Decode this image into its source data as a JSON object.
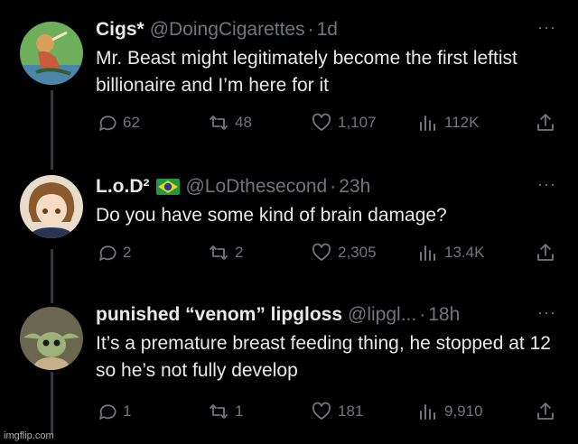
{
  "tweets": [
    {
      "name": "Cigs*",
      "handle": "@DoingCigarettes",
      "dot": "·",
      "time": "1d",
      "text": "Mr. Beast might legitimately become the first leftist billionaire and I’m here for it",
      "replies": "62",
      "retweets": "48",
      "likes": "1,107",
      "views": "112K",
      "more": "···"
    },
    {
      "name": "L.o.D²",
      "handle": "@LoDthesecond",
      "dot": "·",
      "time": "23h",
      "text": "Do you have some kind of brain damage?",
      "replies": "2",
      "retweets": "2",
      "likes": "2,305",
      "views": "13.4K",
      "more": "···"
    },
    {
      "name": "punished “venom” lipgloss",
      "handle": "@lipgl...",
      "dot": "·",
      "time": "18h",
      "text": "It’s a premature breast feeding thing, he stopped at 12 so he’s not fully develop",
      "replies": "1",
      "retweets": "1",
      "likes": "181",
      "views": "9,910",
      "more": "···"
    }
  ],
  "icons": [
    "reply-icon",
    "retweet-icon",
    "like-icon",
    "views-icon",
    "share-icon",
    "more-icon",
    "brazil-flag-icon"
  ],
  "colors": {
    "background": "#000000",
    "text": "#e7e9ea",
    "muted": "#71767b",
    "thread_line": "#333639"
  },
  "watermark": "imgflip.com"
}
